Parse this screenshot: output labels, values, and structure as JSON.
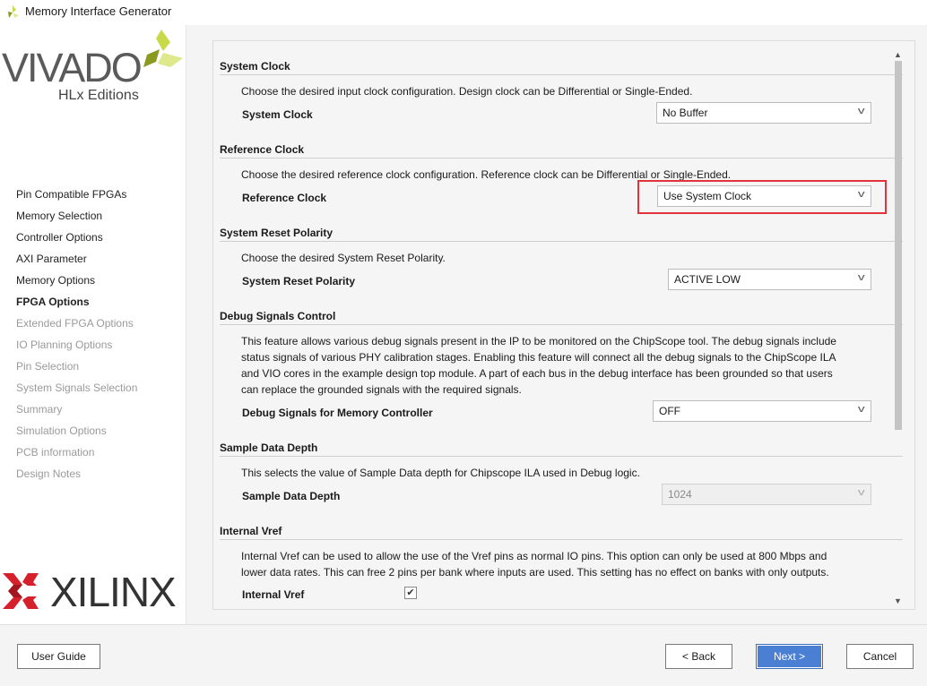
{
  "window": {
    "title": "Memory Interface Generator"
  },
  "brand": {
    "vivado": "VIVADO",
    "edition": "HLx Editions",
    "xilinx": "XILINX",
    "accent": "#c8d94a",
    "xilinx_red": "#d6202c"
  },
  "sidebar": {
    "items": [
      {
        "label": "Pin Compatible FPGAs",
        "state": "done"
      },
      {
        "label": "Memory Selection",
        "state": "done"
      },
      {
        "label": "Controller Options",
        "state": "done"
      },
      {
        "label": "AXI Parameter",
        "state": "done"
      },
      {
        "label": "Memory Options",
        "state": "done"
      },
      {
        "label": "FPGA Options",
        "state": "current"
      },
      {
        "label": "Extended FPGA Options",
        "state": "todo"
      },
      {
        "label": "IO Planning Options",
        "state": "todo"
      },
      {
        "label": "Pin Selection",
        "state": "todo"
      },
      {
        "label": "System Signals Selection",
        "state": "todo"
      },
      {
        "label": "Summary",
        "state": "todo"
      },
      {
        "label": "Simulation Options",
        "state": "todo"
      },
      {
        "label": "PCB information",
        "state": "todo"
      },
      {
        "label": "Design Notes",
        "state": "todo"
      }
    ]
  },
  "sections": {
    "system_clock": {
      "heading": "System Clock",
      "desc": "Choose the desired input clock configuration. Design clock can be Differential or Single-Ended.",
      "label": "System Clock",
      "value": "No Buffer"
    },
    "reference_clock": {
      "heading": "Reference Clock",
      "desc": "Choose the desired reference clock configuration. Reference clock can be Differential or Single-Ended.",
      "label": "Reference Clock",
      "value": "Use System Clock",
      "highlight_color": "#e0333a"
    },
    "reset": {
      "heading": "System Reset Polarity",
      "desc": "Choose the desired System Reset Polarity.",
      "label": "System Reset Polarity",
      "value": "ACTIVE LOW"
    },
    "debug": {
      "heading": "Debug Signals Control",
      "desc": [
        "This feature allows various debug signals present in the IP to be monitored on the ChipScope tool. The debug signals include",
        "status signals of various PHY calibration stages. Enabling this feature will connect all the debug signals to the ChipScope ILA",
        "and VIO cores in the example design top module. A part of each bus in the debug interface has been grounded so that users",
        "can replace the grounded signals with the required signals."
      ],
      "label": "Debug Signals for Memory Controller",
      "value": "OFF"
    },
    "sample": {
      "heading": "Sample Data Depth",
      "desc": "This selects the value of Sample Data depth for Chipscope ILA used in Debug logic.",
      "label": "Sample Data Depth",
      "value": "1024",
      "disabled": true
    },
    "vref": {
      "heading": "Internal Vref",
      "desc": [
        "Internal Vref can be used to allow the use of the Vref pins as normal IO pins. This option can only be used at 800 Mbps and",
        "lower data rates. This can free 2 pins per bank where inputs are used. This setting has no effect on banks with only outputs."
      ],
      "label": "Internal Vref",
      "checked": true
    }
  },
  "footer": {
    "user_guide": "User Guide",
    "back": "< Back",
    "next": "Next >",
    "cancel": "Cancel"
  }
}
